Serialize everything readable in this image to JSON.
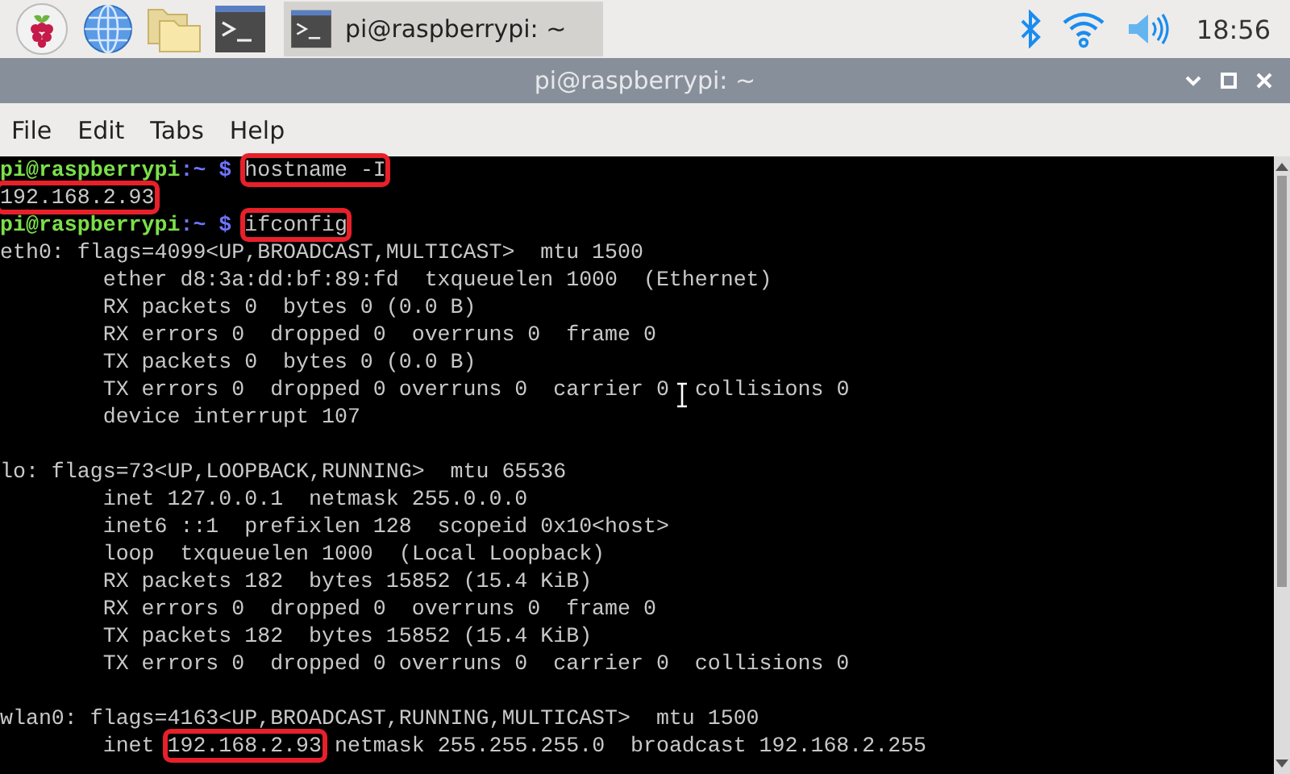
{
  "taskbar": {
    "launchers": [
      {
        "kind": "raspberry"
      },
      {
        "kind": "globe"
      },
      {
        "kind": "folder"
      },
      {
        "kind": "terminal"
      }
    ],
    "tasks": [
      {
        "label": "pi@raspberrypi: ~",
        "selected": true
      }
    ],
    "clock": "18:56"
  },
  "window": {
    "title": "pi@raspberrypi: ~"
  },
  "menu": [
    "File",
    "Edit",
    "Tabs",
    "Help"
  ],
  "terminal": {
    "lines": [
      {
        "kind": "text",
        "segments": [
          {
            "kind": "user",
            "text": "pi@raspberrypi",
            "highlighted": false
          },
          {
            "kind": "path",
            "text": ":~ $",
            "highlighted": false
          },
          {
            "kind": "command",
            "text": "hostname -I",
            "highlighted": true
          }
        ]
      },
      {
        "kind": "text",
        "segments": [
          {
            "kind": "output",
            "text": "192.168.2.93",
            "highlighted": true
          }
        ]
      },
      {
        "kind": "text",
        "segments": [
          {
            "kind": "user",
            "text": "pi@raspberrypi",
            "highlighted": false
          },
          {
            "kind": "path",
            "text": ":~ $",
            "highlighted": false
          },
          {
            "kind": "command",
            "text": "ifconfig",
            "highlighted": true
          }
        ]
      },
      {
        "kind": "text",
        "segments": [
          {
            "kind": "output",
            "text": "eth0: flags=4099<UP,BROADCAST,MULTICAST>  mtu 1500",
            "highlighted": false
          }
        ]
      },
      {
        "kind": "text",
        "segments": [
          {
            "kind": "output",
            "text": "        ether d8:3a:dd:bf:89:fd  txqueuelen 1000  (Ethernet)",
            "highlighted": false
          }
        ]
      },
      {
        "kind": "text",
        "segments": [
          {
            "kind": "output",
            "text": "        RX packets 0  bytes 0 (0.0 B)",
            "highlighted": false
          }
        ]
      },
      {
        "kind": "text",
        "segments": [
          {
            "kind": "output",
            "text": "        RX errors 0  dropped 0  overruns 0  frame 0",
            "highlighted": false
          }
        ]
      },
      {
        "kind": "text",
        "segments": [
          {
            "kind": "output",
            "text": "        TX packets 0  bytes 0 (0.0 B)",
            "highlighted": false
          }
        ]
      },
      {
        "kind": "text",
        "segments": [
          {
            "kind": "output",
            "text": "        TX errors 0  dropped 0 overruns 0  carrier 0",
            "highlighted": false,
            "pointer_after": true
          },
          {
            "kind": "output",
            "text": "collisions 0",
            "highlighted": false
          }
        ]
      },
      {
        "kind": "text",
        "segments": [
          {
            "kind": "output",
            "text": "        device interrupt 107",
            "highlighted": false
          }
        ]
      },
      {
        "kind": "blank"
      },
      {
        "kind": "text",
        "segments": [
          {
            "kind": "output",
            "text": "lo: flags=73<UP,LOOPBACK,RUNNING>  mtu 65536",
            "highlighted": false
          }
        ]
      },
      {
        "kind": "text",
        "segments": [
          {
            "kind": "output",
            "text": "        inet 127.0.0.1  netmask 255.0.0.0",
            "highlighted": false
          }
        ]
      },
      {
        "kind": "text",
        "segments": [
          {
            "kind": "output",
            "text": "        inet6 ::1  prefixlen 128  scopeid 0x10<host>",
            "highlighted": false
          }
        ]
      },
      {
        "kind": "text",
        "segments": [
          {
            "kind": "output",
            "text": "        loop  txqueuelen 1000  (Local Loopback)",
            "highlighted": false
          }
        ]
      },
      {
        "kind": "text",
        "segments": [
          {
            "kind": "output",
            "text": "        RX packets 182  bytes 15852 (15.4 KiB)",
            "highlighted": false
          }
        ]
      },
      {
        "kind": "text",
        "segments": [
          {
            "kind": "output",
            "text": "        RX errors 0  dropped 0  overruns 0  frame 0",
            "highlighted": false
          }
        ]
      },
      {
        "kind": "text",
        "segments": [
          {
            "kind": "output",
            "text": "        TX packets 182  bytes 15852 (15.4 KiB)",
            "highlighted": false
          }
        ]
      },
      {
        "kind": "text",
        "segments": [
          {
            "kind": "output",
            "text": "        TX errors 0  dropped 0 overruns 0  carrier 0  collisions 0",
            "highlighted": false
          }
        ]
      },
      {
        "kind": "blank"
      },
      {
        "kind": "text",
        "segments": [
          {
            "kind": "output",
            "text": "wlan0: flags=4163<UP,BROADCAST,RUNNING,MULTICAST>  mtu 1500",
            "highlighted": false
          }
        ]
      },
      {
        "kind": "text",
        "segments": [
          {
            "kind": "output",
            "text": "        inet ",
            "highlighted": false
          },
          {
            "kind": "output",
            "text": "192.168.2.93",
            "highlighted": true
          },
          {
            "kind": "output",
            "text": " netmask 255.255.255.0  broadcast 192.168.2.255",
            "highlighted": false
          }
        ]
      }
    ]
  }
}
